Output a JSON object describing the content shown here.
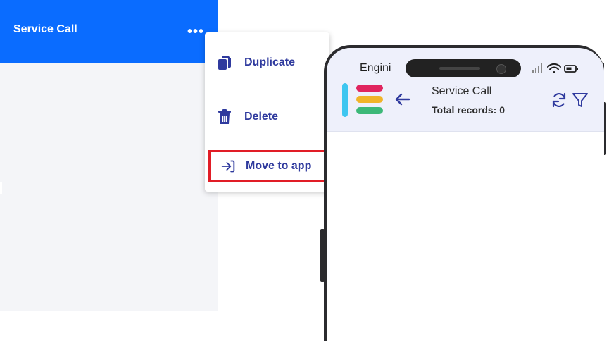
{
  "left_panel": {
    "title": "Service Call",
    "more_icon": "more-horizontal-icon",
    "header_color": "#0a6cff"
  },
  "context_menu": {
    "items": [
      {
        "label": "Duplicate",
        "icon": "duplicate-icon"
      },
      {
        "label": "Delete",
        "icon": "trash-icon"
      },
      {
        "label": "Move to app",
        "icon": "move-to-app-icon",
        "highlighted": true,
        "highlight_color": "#e11d26"
      }
    ],
    "text_color": "#2f3a9e"
  },
  "phone": {
    "carrier": "Engini",
    "status_icons": [
      "signal-icon",
      "wifi-icon",
      "battery-icon"
    ],
    "header": {
      "title": "Service Call",
      "subtitle": "Total records: 0",
      "logo": "app-logo",
      "back_icon": "back-arrow-icon",
      "refresh_icon": "refresh-icon",
      "filter_icon": "filter-icon"
    },
    "logo_colors": [
      "#3ec6f0",
      "#e0245e",
      "#f0b429",
      "#3cb878"
    ]
  }
}
